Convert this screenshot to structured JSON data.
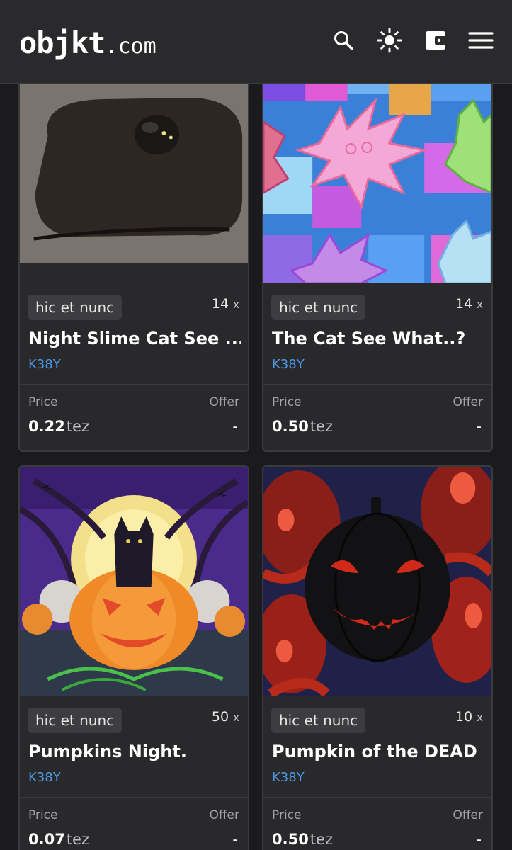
{
  "header": {
    "logo_main": "objkt",
    "logo_tld": ".com",
    "icons": [
      "search-icon",
      "sun-icon",
      "wallet-icon",
      "menu-icon"
    ]
  },
  "colors": {
    "background": "#1b1b1d",
    "card": "#29292b",
    "artist_link": "#4a9be8",
    "tag_bg": "#3d3d40"
  },
  "cards": [
    {
      "platform": "hic et nunc",
      "editions": "14",
      "edition_suffix": "x",
      "title": "Night Slime Cat See ...",
      "artist": "K38Y",
      "price_label": "Price",
      "price": "0.22",
      "unit": "tez",
      "offer_label": "Offer",
      "offer": "-"
    },
    {
      "platform": "hic et nunc",
      "editions": "14",
      "edition_suffix": "x",
      "title": "The Cat See What..?",
      "artist": "K38Y",
      "price_label": "Price",
      "price": "0.50",
      "unit": "tez",
      "offer_label": "Offer",
      "offer": "-"
    },
    {
      "platform": "hic et nunc",
      "editions": "50",
      "edition_suffix": "x",
      "title": "Pumpkins Night.",
      "artist": "K38Y",
      "price_label": "Price",
      "price": "0.07",
      "unit": "tez",
      "offer_label": "Offer",
      "offer": "-"
    },
    {
      "platform": "hic et nunc",
      "editions": "10",
      "edition_suffix": "x",
      "title": "Pumpkin of the DEAD",
      "artist": "K38Y",
      "price_label": "Price",
      "price": "0.50",
      "unit": "tez",
      "offer_label": "Offer",
      "offer": "-"
    }
  ]
}
